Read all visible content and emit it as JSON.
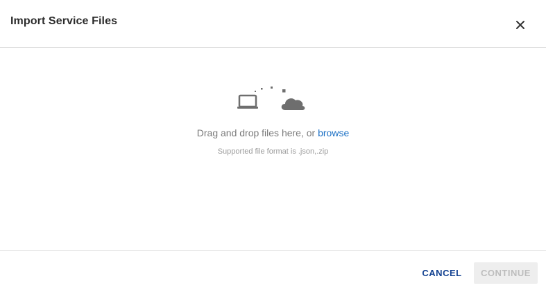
{
  "dialog": {
    "title": "Import Service Files",
    "close_icon": "close-icon"
  },
  "dropzone": {
    "illustration_icons": [
      "laptop-icon",
      "cloud-icon"
    ],
    "drop_prefix": "Drag and drop files here, or ",
    "browse_label": "browse",
    "format_hint": "Supported file format is .json,.zip"
  },
  "footer": {
    "cancel_label": "CANCEL",
    "continue_label": "CONTINUE",
    "continue_disabled": true
  },
  "colors": {
    "accent": "#124191",
    "link": "#1a6fc4",
    "icon": "#6e6e6e",
    "disabled_bg": "#eeeeee",
    "disabled_text": "#bdbdbd"
  }
}
